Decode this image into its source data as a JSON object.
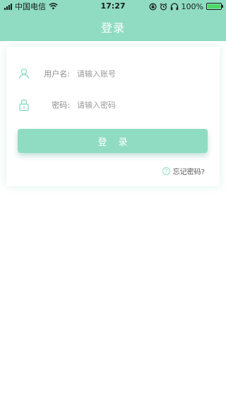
{
  "status_bar": {
    "carrier": "中国电信",
    "time": "17:27",
    "battery": "100%"
  },
  "navbar": {
    "title": "登录"
  },
  "form": {
    "username_label": "用户名:",
    "username_placeholder": "请输入账号",
    "password_label": "密码:",
    "password_placeholder": "请输入密码",
    "login_label": "登 录",
    "forgot_label": "忘记密码?"
  },
  "colors": {
    "accent": "#8fdcc3",
    "background": "#ffffff"
  },
  "icons": {
    "username": "user-icon",
    "password": "lock-icon",
    "forgot": "question-icon"
  }
}
